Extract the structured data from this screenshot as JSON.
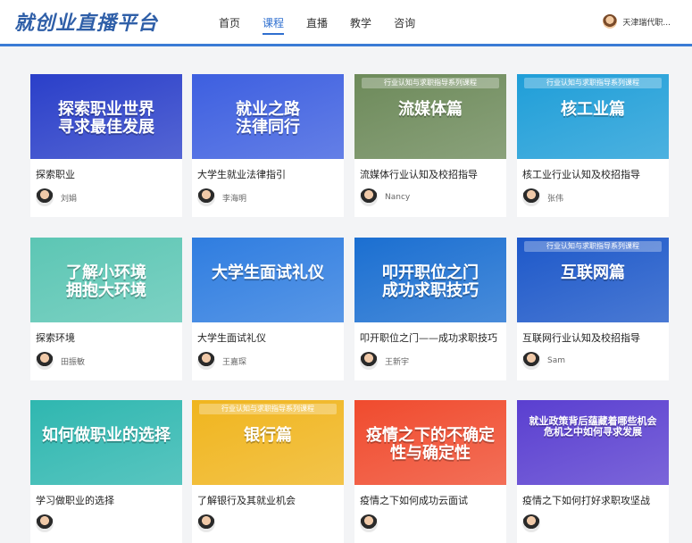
{
  "header": {
    "logo": "就创业直播平台",
    "nav": [
      "首页",
      "课程",
      "直播",
      "教学",
      "咨询"
    ],
    "active_nav": "课程",
    "user_name": "天津瑞代职..."
  },
  "courses": [
    {
      "title": "探索职业",
      "author": "刘娟",
      "thumb_text": "探索职业世界\n寻求最佳发展",
      "bg": "#2a3fc9"
    },
    {
      "title": "大学生就业法律指引",
      "author": "李海明",
      "thumb_text": "就业之路\n法律同行",
      "bg": "#3d5fe0"
    },
    {
      "title": "流媒体行业认知及校招指导",
      "author": "Nancy",
      "thumb_text": "流媒体篇",
      "banner": "行业认知与求职指导系列课程",
      "bg": "#6d8a5a"
    },
    {
      "title": "核工业行业认知及校招指导",
      "author": "张伟",
      "thumb_text": "核工业篇",
      "banner": "行业认知与求职指导系列课程",
      "bg": "#1f9ed8"
    },
    {
      "title": "探索环境",
      "author": "田振敏",
      "thumb_text": "了解小环境\n拥抱大环境",
      "bg": "#5cc6b4"
    },
    {
      "title": "大学生面试礼仪",
      "author": "王嘉琛",
      "thumb_text": "大学生面试礼仪",
      "bg": "#2f7de0"
    },
    {
      "title": "叩开职位之门——成功求职技巧",
      "author": "王新宇",
      "thumb_text": "叩开职位之门\n成功求职技巧",
      "bg": "#1b6fd1"
    },
    {
      "title": "互联网行业认知及校招指导",
      "author": "Sam",
      "thumb_text": "互联网篇",
      "banner": "行业认知与求职指导系列课程",
      "bg": "#1d58c9"
    },
    {
      "title": "学习做职业的选择",
      "author": "",
      "thumb_text": "如何做职业的选择",
      "bg": "#2fb7b0"
    },
    {
      "title": "了解银行及其就业机会",
      "author": "",
      "thumb_text": "银行篇",
      "banner": "行业认知与求职指导系列课程",
      "bg": "#f0b51e"
    },
    {
      "title": "疫情之下如何成功云面试",
      "author": "",
      "thumb_text": "疫情之下的不确定性与确定性",
      "bg": "#f04b2e"
    },
    {
      "title": "疫情之下如何打好求职攻坚战",
      "author": "",
      "thumb_text": "就业政策背后蕴藏着哪些机会\n危机之中如何寻求发展",
      "bg": "#5a3fd0"
    }
  ]
}
